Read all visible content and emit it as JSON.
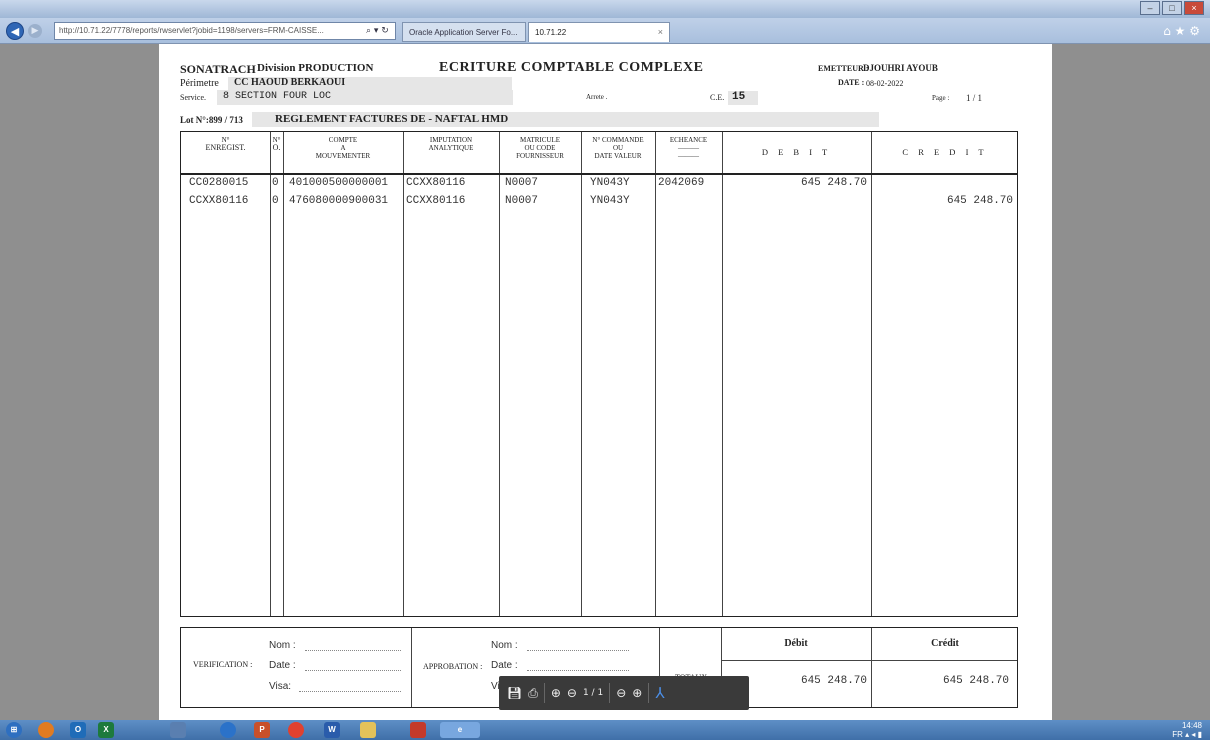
{
  "browser": {
    "address": "http://10.71.22/7778/reports/rwservlet?jobid=1198/servers=FRM-CAISSE...",
    "address_tools": "⌕ ▾ ↻",
    "tabs": [
      {
        "label": "Oracle Application Server Fo..."
      },
      {
        "label": "10.71.22",
        "close": "×"
      }
    ],
    "window_controls": {
      "minimize": "–",
      "maximize": "□",
      "close": "×"
    },
    "toolbar_icons": "⌂ ★ ⚙"
  },
  "doc": {
    "company": "SONATRACH",
    "division": "Division PRODUCTION",
    "title": "ECRITURE COMPTABLE COMPLEXE",
    "emetteur_label": "EMETTEUR :",
    "emetteur": "DJOUHRI AYOUB",
    "perimetre_label": "Périmetre",
    "perimetre": "CC HAOUD BERKAOUI",
    "date_label": "DATE :",
    "date": "08-02-2022",
    "service_label": "Service.",
    "service": "8 SECTION FOUR LOC",
    "arrete_label": "Arrete .",
    "ce_label": "C.E.",
    "ce": "15",
    "page_label": "Page :",
    "page": "1 / 1",
    "lot_label": "Lot N°:899 / 713",
    "lot_desc": "REGLEMENT FACTURES DE - NAFTAL HMD"
  },
  "table": {
    "headers": {
      "enreg": [
        "N°",
        "ENREGIST."
      ],
      "no": [
        "N°",
        "O."
      ],
      "compte": [
        "COMPTE",
        "A",
        "MOUVEMENTER"
      ],
      "imputation": [
        "IMPUTATION",
        "",
        "ANALYTIQUE"
      ],
      "matricule": [
        "MATRICULE",
        "OU CODE",
        "FOURNISSEUR"
      ],
      "commande": [
        "N° COMMANDE",
        "OU",
        "DATE VALEUR"
      ],
      "echeance": [
        "ECHEANCE",
        "———",
        "———"
      ],
      "debit": "D E B I T",
      "credit": "C R E D I T"
    },
    "rows": [
      {
        "enreg": "CC0280015",
        "no": "0",
        "compte": "401000500000001",
        "imputation": "CCXX80116",
        "matricule": "N0007",
        "commande": "YN043Y",
        "echeance": "2042069",
        "debit": "645 248.70",
        "credit": ""
      },
      {
        "enreg": "CCXX80116",
        "no": "0",
        "compte": "476080000900031",
        "imputation": "CCXX80116",
        "matricule": "N0007",
        "commande": "YN043Y",
        "echeance": "",
        "debit": "",
        "credit": "645 248.70"
      }
    ]
  },
  "footer": {
    "verification": "VERIFICATION :",
    "approbation": "APPROBATION :",
    "nom": "Nom :",
    "date": "Date :",
    "visa": "Visa:",
    "totaux": "TOTAUX :",
    "debit_label": "Débit",
    "credit_label": "Crédit",
    "total_debit": "645 248.70",
    "total_credit": "645 248.70"
  },
  "pdf_toolbar": {
    "page_indicator": "1 / 1",
    "icons": [
      "save-icon",
      "print-icon",
      "page-up-icon",
      "page-down-icon",
      "zoom-out-icon",
      "zoom-in-icon",
      "acrobat-icon"
    ]
  },
  "taskbar": {
    "time": "14:48",
    "tray": "FR ▴ ◂ ▮"
  }
}
